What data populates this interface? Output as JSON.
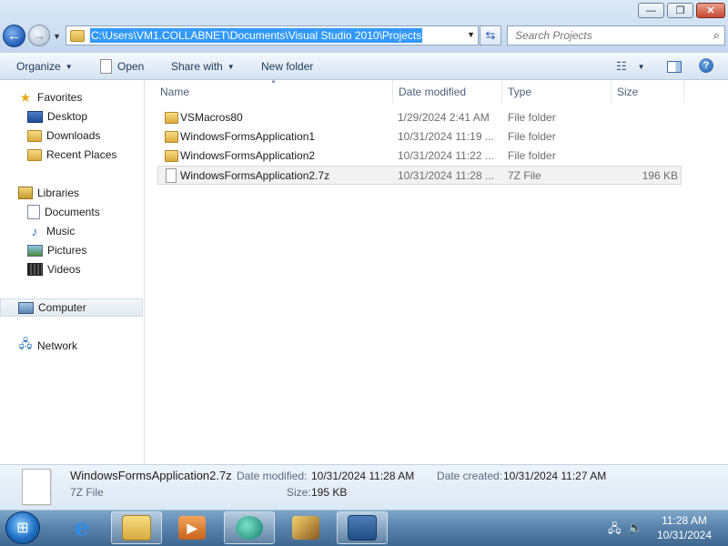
{
  "window": {
    "minimize_glyph": "—",
    "maximize_glyph": "❐",
    "close_glyph": "✕"
  },
  "address": {
    "path": "C:\\Users\\VM1.COLLABNET\\Documents\\Visual Studio 2010\\Projects"
  },
  "search": {
    "placeholder": "Search Projects"
  },
  "toolbar": {
    "organize": "Organize",
    "open": "Open",
    "share_with": "Share with",
    "new_folder": "New folder"
  },
  "nav": {
    "favorites": "Favorites",
    "desktop": "Desktop",
    "downloads": "Downloads",
    "recent_places": "Recent Places",
    "libraries": "Libraries",
    "documents": "Documents",
    "music": "Music",
    "pictures": "Pictures",
    "videos": "Videos",
    "computer": "Computer",
    "network": "Network"
  },
  "columns": {
    "name": "Name",
    "date_modified": "Date modified",
    "type": "Type",
    "size": "Size"
  },
  "files": [
    {
      "name": "VSMacros80",
      "date": "1/29/2024 2:41 AM",
      "type": "File folder",
      "size": ""
    },
    {
      "name": "WindowsFormsApplication1",
      "date": "10/31/2024 11:19 ...",
      "type": "File folder",
      "size": ""
    },
    {
      "name": "WindowsFormsApplication2",
      "date": "10/31/2024 11:22 ...",
      "type": "File folder",
      "size": ""
    },
    {
      "name": "WindowsFormsApplication2.7z",
      "date": "10/31/2024 11:28 ...",
      "type": "7Z File",
      "size": "196 KB"
    }
  ],
  "details": {
    "name": "WindowsFormsApplication2.7z",
    "type": "7Z File",
    "date_modified_label": "Date modified:",
    "date_modified": "10/31/2024 11:28 AM",
    "date_created_label": "Date created:",
    "date_created": "10/31/2024 11:27 AM",
    "size_label": "Size:",
    "size": "195 KB"
  },
  "taskbar": {
    "time": "11:28 AM",
    "date": "10/31/2024"
  }
}
